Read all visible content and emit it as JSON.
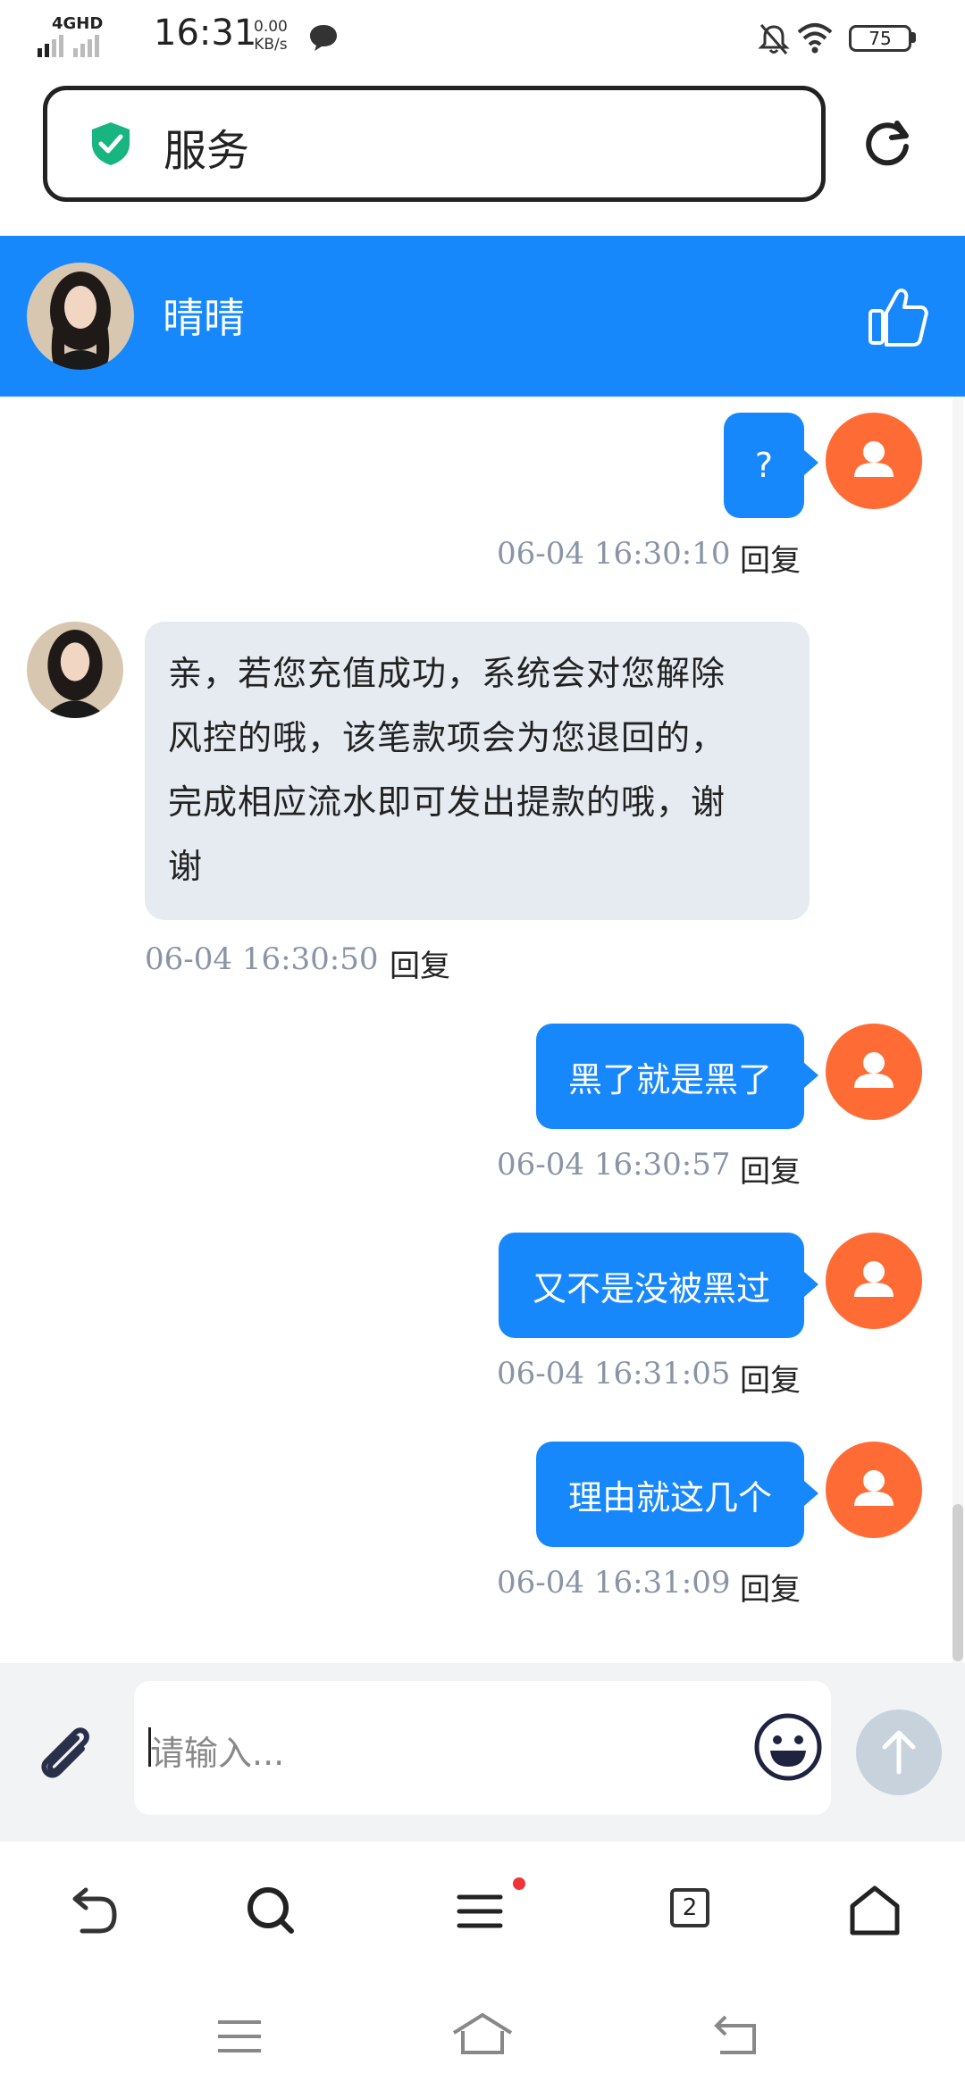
{
  "status_bar": {
    "network": "4GHD",
    "time": "16:31",
    "speed_value": "0.00",
    "speed_unit": "KB/s",
    "battery": "75"
  },
  "browser": {
    "url_title": "服务",
    "secure_icon": "shield-check-icon",
    "reload_icon": "reload-icon"
  },
  "chat": {
    "contact_name": "晴晴",
    "like_icon": "thumbs-up-icon",
    "reply_label": "回复",
    "messages": [
      {
        "side": "out",
        "text": "?",
        "time": "06-04 16:30:10"
      },
      {
        "side": "in",
        "lines": [
          "亲，若您充值成功，系统会对您解除",
          "风控的哦，该笔款项会为您退回的，",
          "完成相应流水即可发出提款的哦，谢",
          "谢"
        ],
        "time": "06-04 16:30:50"
      },
      {
        "side": "out",
        "text": "黑了就是黑了",
        "time": "06-04 16:30:57"
      },
      {
        "side": "out",
        "text": "又不是没被黑过",
        "time": "06-04 16:31:05"
      },
      {
        "side": "out",
        "text": "理由就这几个",
        "time": "06-04 16:31:09"
      }
    ]
  },
  "composer": {
    "placeholder": "请输入...",
    "attach_icon": "paperclip-icon",
    "emoji_icon": "smiley-icon",
    "send_icon": "send-arrow-icon"
  },
  "browser_nav": {
    "tab_count": "2",
    "icons": [
      "back-icon",
      "search-icon",
      "menu-icon",
      "tabs-icon",
      "home-icon"
    ]
  },
  "colors": {
    "brand_blue": "#1787fc",
    "user_avatar": "#ff6b35",
    "incoming_bubble": "#e6ebf2"
  }
}
